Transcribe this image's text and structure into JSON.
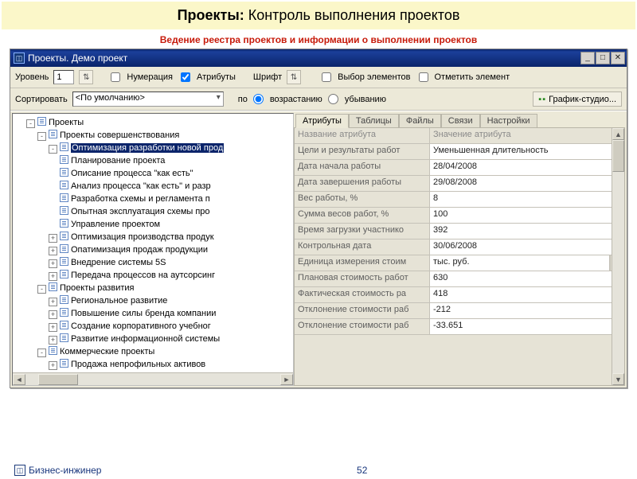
{
  "slide": {
    "title_bold": "Проекты:",
    "title_rest": " Контроль выполнения проектов",
    "subtitle": "Ведение реестра проектов и информации о выполнении проектов"
  },
  "window": {
    "title": "Проекты. Демо проект"
  },
  "toolbar1": {
    "level_lbl": "Уровень",
    "level_val": "1",
    "numbering": "Нумерация",
    "attributes": "Атрибуты",
    "font_lbl": "Шрифт",
    "select_elements": "Выбор элементов",
    "mark_element": "Отметить элемент"
  },
  "toolbar2": {
    "sort_lbl": "Сортировать",
    "sort_val": "<По умолчанию>",
    "by": "по",
    "asc": "возрастанию",
    "desc": "убыванию",
    "gstudio": "График-студио..."
  },
  "tree": {
    "root": "Проекты",
    "g1": "Проекты совершенствования",
    "g1_sel": "Оптимизация разработки новой прод",
    "g1_c": [
      "Планирование проекта",
      "Описание процесса \"как есть\"",
      "Анализ процесса \"как есть\" и разр",
      "Разработка схемы и регламента п",
      "Опытная эксплуатация схемы про",
      "Управление проектом"
    ],
    "g1_sib": [
      "Оптимизация производства продук",
      "Опатимизация продаж продукции",
      "Внедрение системы 5S",
      "Передача процессов на аутсорсинг"
    ],
    "g2": "Проекты развития",
    "g2_c": [
      "Региональное развитие",
      "Повышение силы бренда компании",
      "Создание корпоративного учебног",
      "Развитие информационной системы"
    ],
    "g3": "Коммерческие проекты",
    "g3_c": [
      "Продажа непрофильных активов"
    ]
  },
  "tabs": [
    "Атрибуты",
    "Таблицы",
    "Файлы",
    "Связи",
    "Настройки"
  ],
  "attrs": {
    "header_name": "Название атрибута",
    "header_value": "Значение атрибута",
    "rows": [
      {
        "n": "Цели и результаты работ",
        "v": "Уменьшенная длительность"
      },
      {
        "n": "Дата начала работы",
        "v": "28/04/2008"
      },
      {
        "n": "Дата завершения работы",
        "v": "29/08/2008"
      },
      {
        "n": "Вес работы, %",
        "v": "8"
      },
      {
        "n": "Сумма весов работ, %",
        "v": "100"
      },
      {
        "n": "Время загрузки участнико",
        "v": "392"
      },
      {
        "n": "Контрольная дата",
        "v": "30/06/2008"
      },
      {
        "n": "Единица измерения стоим",
        "v": "тыс. руб."
      },
      {
        "n": "Плановая стоимость работ",
        "v": "630"
      },
      {
        "n": "Фактическая стоимость ра",
        "v": "418"
      },
      {
        "n": "Отклонение стоимости раб",
        "v": "-212"
      },
      {
        "n": "Отклонение стоимости раб",
        "v": "-33.651"
      }
    ]
  },
  "footer": {
    "brand": "Бизнес-инжинер",
    "page": "52"
  }
}
